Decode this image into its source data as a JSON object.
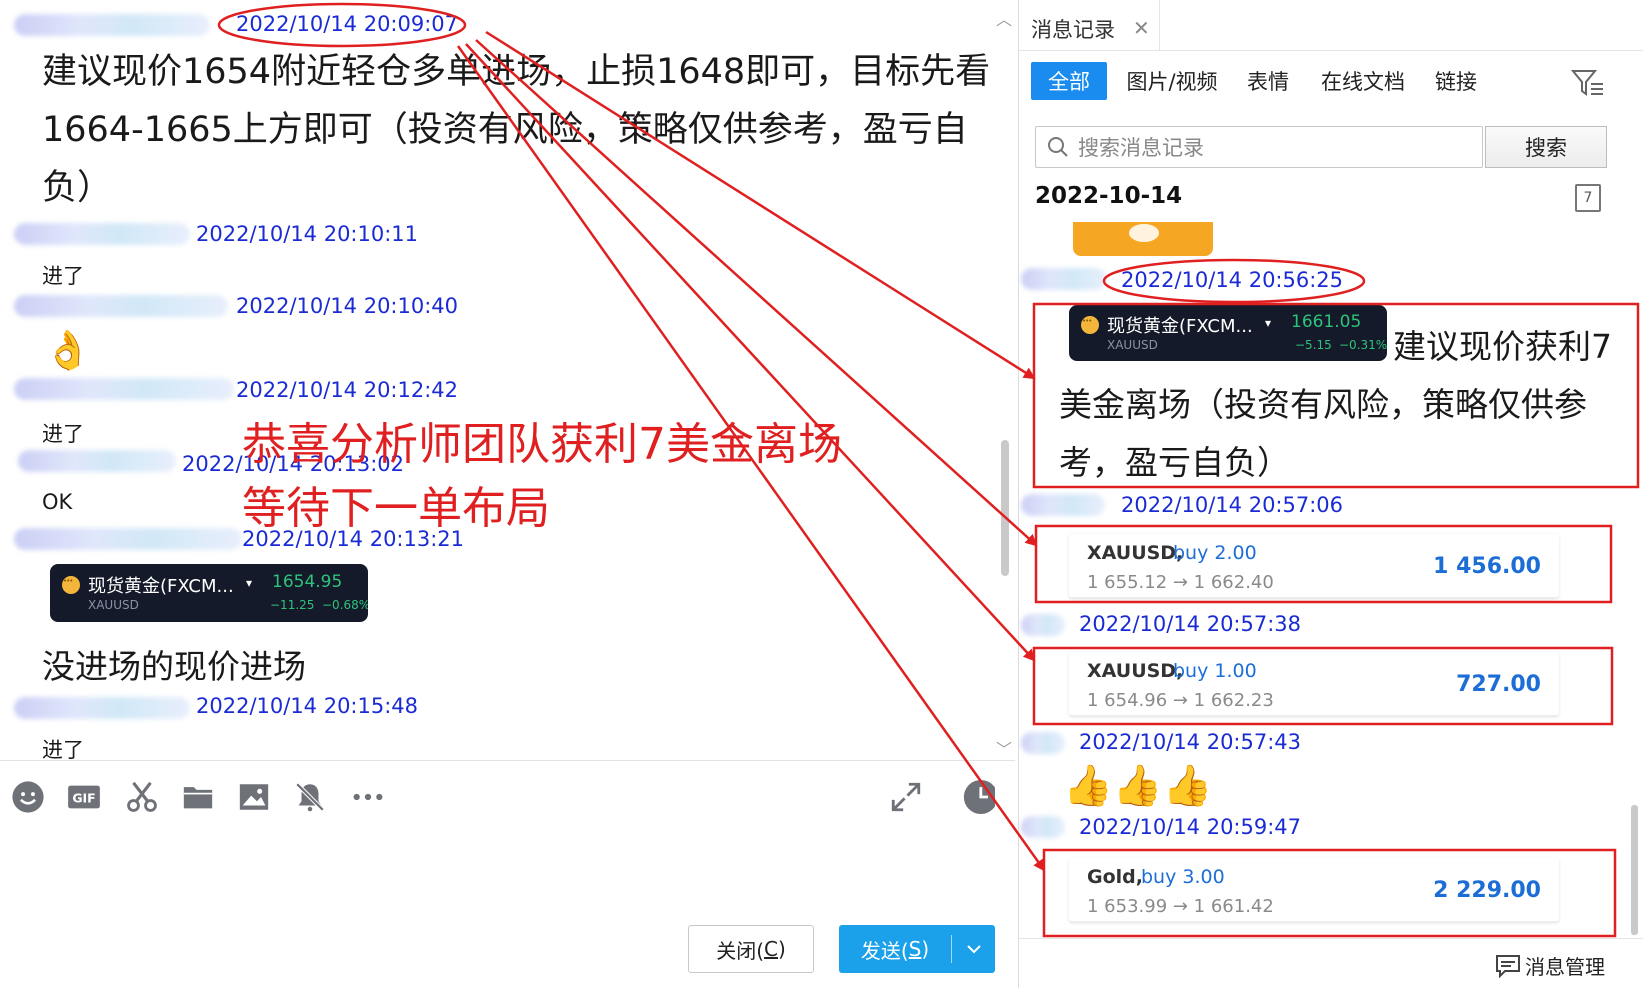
{
  "chat": {
    "messages": [
      {
        "time": "2022/10/14 20:09:07",
        "lines": [
          "建议现价1654附近轻仓多单进场，止损1648即可，目标先看",
          "1664-1665上方即可（投资有风险，策略仅供参考，盈亏自",
          "负）"
        ]
      },
      {
        "time": "2022/10/14 20:10:11",
        "text": "进了"
      },
      {
        "time": "2022/10/14 20:10:40",
        "emoji": "👌"
      },
      {
        "time": "2022/10/14 20:12:42",
        "text": "进了"
      },
      {
        "time": "2022/10/14 20:13:02",
        "text": "OK"
      },
      {
        "time": "2022/10/14 20:13:21",
        "card": {
          "name": "现货黄金(FXCM...",
          "symbol": "XAUUSD",
          "price": "1654.95",
          "change": "−11.25",
          "change_pct": "−0.68%"
        }
      },
      {
        "text": "没进场的现价进场"
      },
      {
        "time": "2022/10/14 20:15:48",
        "text": "进了"
      }
    ],
    "announcement": [
      "恭喜分析师团队获利7美金离场",
      "等待下一单布局"
    ],
    "toolbar": [
      "emoji-icon",
      "gif-icon",
      "scissors-icon",
      "folder-icon",
      "image-icon",
      "mute-bell-icon",
      "more-icon",
      "expand-icon",
      "history-clock-icon"
    ],
    "buttons": {
      "close": "关闭(C)",
      "close_underline": "C",
      "send": "发送(S)",
      "send_underline": "S"
    }
  },
  "history": {
    "tab_title": "消息记录",
    "filters": [
      "全部",
      "图片/视频",
      "表情",
      "在线文档",
      "链接"
    ],
    "search": {
      "placeholder": "搜索消息记录",
      "button": "搜索"
    },
    "date_heading": "2022-10-14",
    "calendar_day": "7",
    "items": [
      {
        "time": "2022/10/14 20:56:25",
        "card": {
          "name": "现货黄金(FXCM...",
          "symbol": "XAUUSD",
          "price": "1661.05",
          "change": "−5.15",
          "change_pct": "−0.31%"
        },
        "lines": [
          "建议现价获利7",
          "美金离场（投资有风险，策略仅供参",
          "考，盈亏自负）"
        ]
      },
      {
        "time": "2022/10/14 20:57:06",
        "trade": {
          "symbol": "XAUUSD,",
          "side": "buy 2.00",
          "prices": "1 655.12 → 1 662.40",
          "profit": "1 456.00"
        }
      },
      {
        "time": "2022/10/14 20:57:38",
        "trade": {
          "symbol": "XAUUSD,",
          "side": "buy 1.00",
          "prices": "1 654.96 → 1 662.23",
          "profit": "727.00"
        }
      },
      {
        "time": "2022/10/14 20:57:43",
        "emoji": "👍👍👍"
      },
      {
        "time": "2022/10/14 20:59:47",
        "trade": {
          "symbol": "Gold,",
          "side": "buy 3.00",
          "prices": "1 653.99 → 1 661.42",
          "profit": "2 229.00"
        }
      }
    ],
    "footer": "消息管理"
  },
  "colors": {
    "accent": "#1a8cef",
    "send": "#1aa1ea",
    "timestamp": "#1a2bd4",
    "annotation": "#e02020",
    "profit": "#1c6ed6",
    "gain_green": "#2fc27b",
    "card_bg": "#141a29"
  }
}
